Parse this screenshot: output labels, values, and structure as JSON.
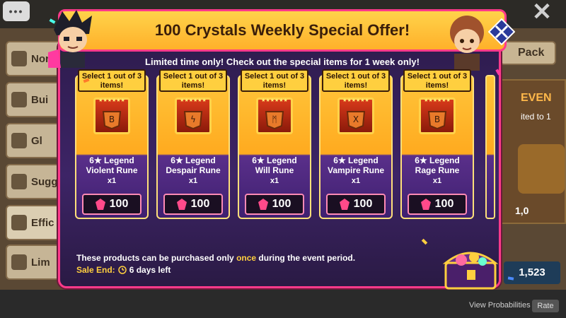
{
  "title": "100 Crystals Weekly Special Offer!",
  "subtitle": "Limited time only! Check out the special items for 1 week only!",
  "cards": [
    {
      "select_label": "Select 1 out of 3 items!",
      "stars": "★★★★★★",
      "name_line1": "6★ Legend",
      "name_line2": "Violent Rune",
      "qty": "x1",
      "price": "100",
      "rune_color": "#c94a1a"
    },
    {
      "select_label": "Select 1 out of 3 items!",
      "stars": "★★★★★★",
      "name_line1": "6★ Legend",
      "name_line2": "Despair Rune",
      "qty": "x1",
      "price": "100",
      "rune_color": "#c94a1a"
    },
    {
      "select_label": "Select 1 out of 3 items!",
      "stars": "★★★★★★",
      "name_line1": "6★ Legend",
      "name_line2": "Will Rune",
      "qty": "x1",
      "price": "100",
      "rune_color": "#c94a1a"
    },
    {
      "select_label": "Select 1 out of 3 items!",
      "stars": "★★★★★★",
      "name_line1": "6★ Legend",
      "name_line2": "Vampire Rune",
      "qty": "x1",
      "price": "100",
      "rune_color": "#c94a1a"
    },
    {
      "select_label": "Select 1 out of 3 items!",
      "stars": "★★★★★★",
      "name_line1": "6★ Legend",
      "name_line2": "Rage Rune",
      "qty": "x1",
      "price": "100",
      "rune_color": "#c94a1a"
    }
  ],
  "note": {
    "before": "These products can be purchased only ",
    "highlight": "once",
    "after": " during the event period."
  },
  "sale_end": {
    "label": "Sale End:",
    "value": "6 days left"
  },
  "background": {
    "side_tabs": [
      "Nor",
      "Bui",
      "Gl",
      "Sugg",
      "Effic",
      "Lim"
    ],
    "pack_label": "Pack",
    "event_title": "EVEN",
    "event_sub": "ited to 1",
    "event_price": "1,0",
    "crystal_count": "1,523",
    "view_probabilities": "View Probabilities",
    "rate": "Rate"
  },
  "colors": {
    "modal_border": "#ff3a8a",
    "title_bg": "#ffc53a",
    "card_top": "#ffb02a",
    "card_bottom": "#3e2070",
    "gem": "#ff4a8a"
  },
  "icons": {
    "chat": "chat-bubble-icon",
    "close": "close-icon",
    "settings": "crossed-swords-icon",
    "gem": "crystal-gem-icon",
    "clock": "clock-icon",
    "chest": "treasure-chest-icon"
  }
}
